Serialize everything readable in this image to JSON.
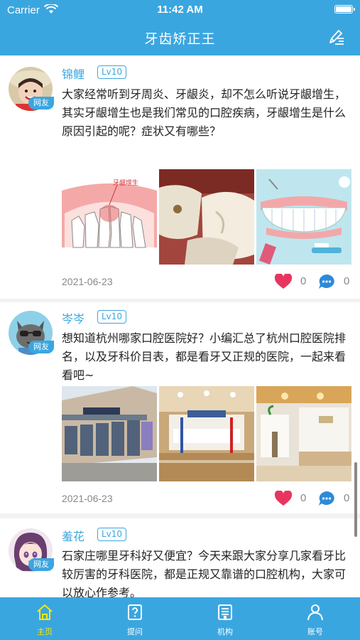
{
  "status_bar": {
    "carrier": "Carrier",
    "time": "11:42 AM"
  },
  "nav": {
    "title": "牙齿矫正王"
  },
  "posts": [
    {
      "username": "锦鲤",
      "level": "Lv10",
      "tag": "网友",
      "text": "大家经常听到牙周炎、牙龈炎，却不怎么听说牙龈增生，其实牙龈增生也是我们常见的口腔疾病，牙龈增生是什么原因引起的呢？症状又有哪些？",
      "image_caption": "牙龈增生",
      "date": "2021-06-23",
      "likes": "0",
      "comments": "0"
    },
    {
      "username": "岑岑",
      "level": "Lv10",
      "tag": "网友",
      "text": "想知道杭州哪家口腔医院好？小编汇总了杭州口腔医院排名，以及牙科价目表，都是看牙又正规的医院，一起来看看吧~",
      "date": "2021-06-23",
      "likes": "0",
      "comments": "0"
    },
    {
      "username": "羞花",
      "level": "Lv10",
      "tag": "网友",
      "text": "石家庄哪里牙科好又便宜？今天来跟大家分享几家看牙比较厉害的牙科医院，都是正规又靠谱的口腔机构，大家可以放心作参考。"
    }
  ],
  "tabs": [
    {
      "label": "主页",
      "icon": "home-icon",
      "active": true
    },
    {
      "label": "提问",
      "icon": "question-icon",
      "active": false
    },
    {
      "label": "机构",
      "icon": "building-icon",
      "active": false
    },
    {
      "label": "账号",
      "icon": "user-icon",
      "active": false
    }
  ],
  "colors": {
    "primary": "#3aa6e0",
    "like": "#e8355f",
    "tab_active": "#ffe600"
  }
}
